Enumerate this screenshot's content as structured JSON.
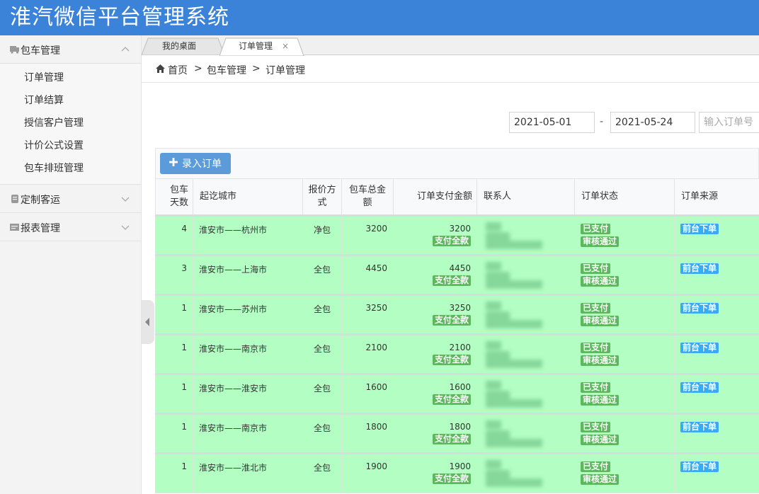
{
  "header": {
    "title": "淮汽微信平台管理系统"
  },
  "sidebar": {
    "groups": [
      {
        "label": "包车管理",
        "expanded": true,
        "items": [
          "订单管理",
          "订单结算",
          "授信客户管理",
          "计价公式设置",
          "包车排班管理"
        ]
      },
      {
        "label": "定制客运",
        "expanded": false
      },
      {
        "label": "报表管理",
        "expanded": false
      }
    ]
  },
  "tabs": [
    {
      "label": "我的桌面",
      "active": false
    },
    {
      "label": "订单管理",
      "active": true,
      "close": "×"
    }
  ],
  "breadcrumb": [
    "首页",
    ">",
    "包车管理",
    ">",
    "订单管理"
  ],
  "filter": {
    "start_date": "2021-05-01",
    "separator": "-",
    "end_date": "2021-05-24",
    "order_no_placeholder": "输入订单号"
  },
  "toolbar": {
    "add_label": "录入订单"
  },
  "table": {
    "columns": [
      "包车天数",
      "起讫城市",
      "报价方式",
      "包车总金额",
      "订单支付金额",
      "联系人",
      "订单状态",
      "订单来源"
    ],
    "column_lines": {
      "days": [
        "包车",
        "天数"
      ],
      "quote": [
        "报价方",
        "式"
      ],
      "total": [
        "包车总金",
        "额"
      ]
    },
    "rows": [
      {
        "days": "4",
        "route": "淮安市——杭州市",
        "quote": "净包",
        "total": "3200",
        "pay": "3200",
        "pay_badge": "支付全款",
        "status1": "已支付",
        "status2": "审核通过",
        "source": "前台下单"
      },
      {
        "days": "3",
        "route": "淮安市——上海市",
        "quote": "全包",
        "total": "4450",
        "pay": "4450",
        "pay_badge": "支付全款",
        "status1": "已支付",
        "status2": "审核通过",
        "source": "前台下单"
      },
      {
        "days": "1",
        "route": "淮安市——苏州市",
        "quote": "全包",
        "total": "3250",
        "pay": "3250",
        "pay_badge": "支付全款",
        "status1": "已支付",
        "status2": "审核通过",
        "source": "前台下单"
      },
      {
        "days": "1",
        "route": "淮安市——南京市",
        "quote": "全包",
        "total": "2100",
        "pay": "2100",
        "pay_badge": "支付全款",
        "status1": "已支付",
        "status2": "审核通过",
        "source": "前台下单"
      },
      {
        "days": "1",
        "route": "淮安市——淮安市",
        "quote": "全包",
        "total": "1600",
        "pay": "1600",
        "pay_badge": "支付全款",
        "status1": "已支付",
        "status2": "审核通过",
        "source": "前台下单"
      },
      {
        "days": "1",
        "route": "淮安市——南京市",
        "quote": "全包",
        "total": "1800",
        "pay": "1800",
        "pay_badge": "支付全款",
        "status1": "已支付",
        "status2": "审核通过",
        "source": "前台下单"
      },
      {
        "days": "1",
        "route": "淮安市——淮北市",
        "quote": "全包",
        "total": "1900",
        "pay": "1900",
        "pay_badge": "支付全款",
        "status1": "已支付",
        "status2": "审核通过",
        "source": "前台下单"
      }
    ]
  },
  "colors": {
    "header_bg": "#3b82d9",
    "row_bg": "#b3ffc3",
    "badge_green": "#5cb85c",
    "badge_blue": "#3ba9ef",
    "button_bg": "#5b9bd9"
  },
  "icons": {
    "menu_1": "bus-icon",
    "menu_2": "clipboard-icon",
    "menu_3": "report-icon",
    "home": "home-icon",
    "add": "plus-icon",
    "collapse": "chevron-left-icon"
  }
}
